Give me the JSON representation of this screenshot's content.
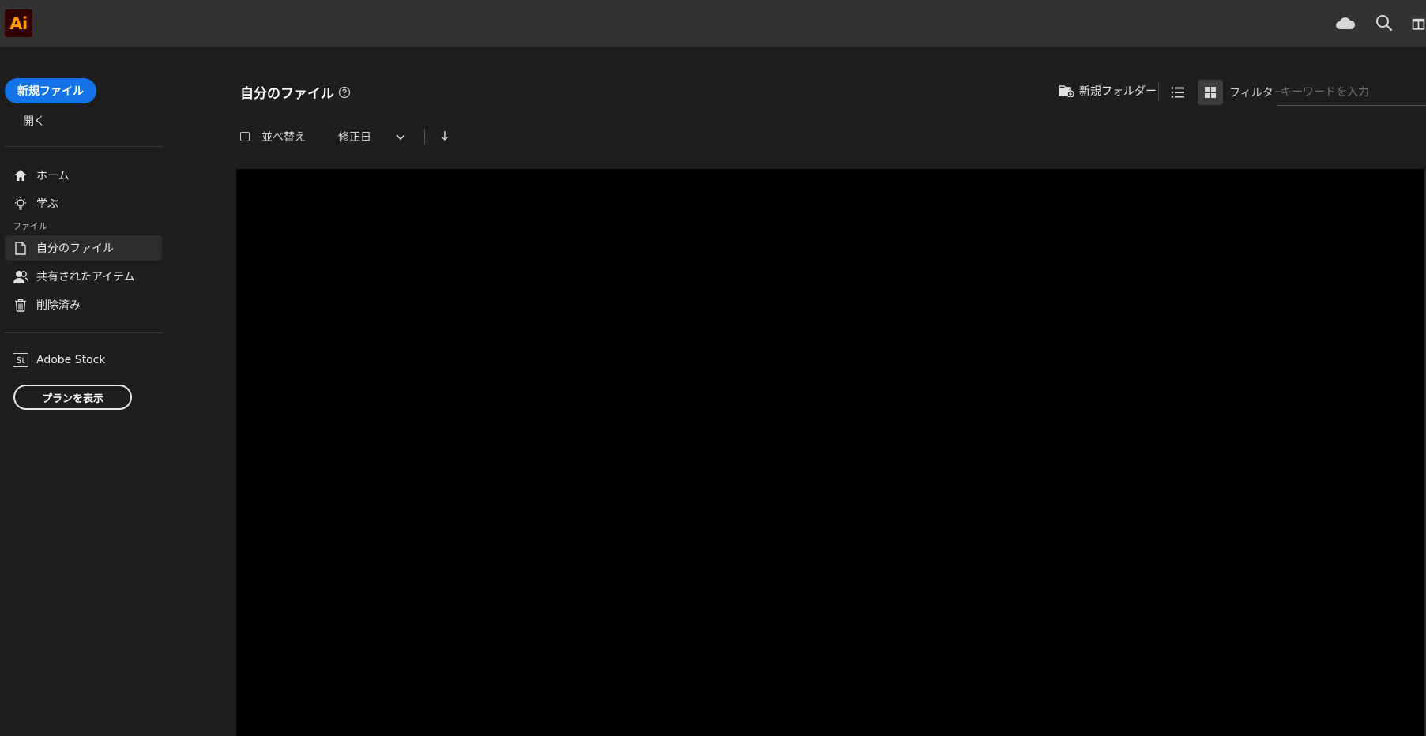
{
  "app": {
    "logo_text": "Ai",
    "accent": "#ff9a00"
  },
  "topbar": {
    "icons": [
      "cloud-icon",
      "search-icon",
      "gift-icon"
    ]
  },
  "sidebar": {
    "new_file_label": "新規ファイル",
    "open_label": "開く",
    "nav": [
      {
        "label": "ホーム",
        "icon": "home-icon"
      },
      {
        "label": "学ぶ",
        "icon": "lightbulb-icon"
      }
    ],
    "files_section_label": "ファイル",
    "files_nav": [
      {
        "label": "自分のファイル",
        "icon": "file-icon",
        "active": true
      },
      {
        "label": "共有されたアイテム",
        "icon": "users-icon"
      },
      {
        "label": "削除済み",
        "icon": "trash-icon"
      }
    ],
    "stock_icon_text": "St",
    "stock_label": "Adobe Stock",
    "plan_button_label": "プランを表示"
  },
  "main": {
    "title": "自分のファイル",
    "sort": {
      "label": "並べ替え",
      "value": "修正日"
    },
    "toolbar": {
      "new_folder_label": "新規フォルダー",
      "filter_label": "フィルター",
      "filter_placeholder": "キーワードを入力",
      "filter_value": ""
    }
  },
  "colors": {
    "primary_button": "#1473e6",
    "topbar_bg": "#323232",
    "page_bg": "#1e1e1e"
  }
}
